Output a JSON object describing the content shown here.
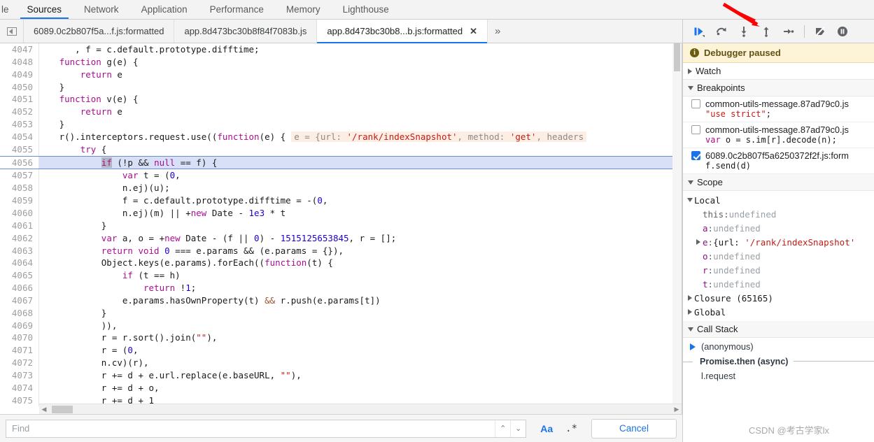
{
  "panel_tabs": [
    {
      "label": "le",
      "active": false,
      "clipped": true
    },
    {
      "label": "Sources",
      "active": true
    },
    {
      "label": "Network",
      "active": false
    },
    {
      "label": "Application",
      "active": false
    },
    {
      "label": "Performance",
      "active": false
    },
    {
      "label": "Memory",
      "active": false
    },
    {
      "label": "Lighthouse",
      "active": false
    }
  ],
  "file_tabs": [
    {
      "label": "6089.0c2b807f5a...f.js:formatted",
      "active": false,
      "closable": false
    },
    {
      "label": "app.8d473bc30b8f84f7083b.js",
      "active": false,
      "closable": false
    },
    {
      "label": "app.8d473bc30b8...b.js:formatted",
      "active": true,
      "closable": true,
      "close_label": "✕"
    }
  ],
  "file_tabs_more": "»",
  "debug_toolbar": {
    "buttons": [
      {
        "name": "resume-script-execution",
        "title": "Resume script execution"
      },
      {
        "name": "step-over-next-function-call",
        "title": "Step over next function call"
      },
      {
        "name": "step-into-next-function-call",
        "title": "Step into next function call"
      },
      {
        "name": "step-out-of-current-function",
        "title": "Step out of current function"
      },
      {
        "name": "step",
        "title": "Step"
      },
      {
        "name": "deactivate-breakpoints",
        "title": "Deactivate breakpoints"
      },
      {
        "name": "pause-on-exceptions",
        "title": "Pause on exceptions"
      }
    ]
  },
  "editor": {
    "first_line_number": 4047,
    "highlighted_line": 4056,
    "lines": [
      {
        "n": 4047,
        "segments": [
          {
            "t": "      , ",
            "c": "plain"
          },
          {
            "t": "f",
            "c": "plain"
          },
          {
            "t": " = ",
            "c": "plain"
          },
          {
            "t": "c",
            "c": "plain"
          },
          {
            "t": ".default.prototype.difftime;",
            "c": "plain"
          }
        ]
      },
      {
        "n": 4048,
        "segments": [
          {
            "t": "   ",
            "c": "plain"
          },
          {
            "t": "function",
            "c": "kw"
          },
          {
            "t": " g(e) {",
            "c": "plain"
          }
        ]
      },
      {
        "n": 4049,
        "segments": [
          {
            "t": "       ",
            "c": "plain"
          },
          {
            "t": "return",
            "c": "kw"
          },
          {
            "t": " e",
            "c": "plain"
          }
        ]
      },
      {
        "n": 4050,
        "segments": [
          {
            "t": "   }",
            "c": "plain"
          }
        ]
      },
      {
        "n": 4051,
        "segments": [
          {
            "t": "   ",
            "c": "plain"
          },
          {
            "t": "function",
            "c": "kw"
          },
          {
            "t": " v(e) {",
            "c": "plain"
          }
        ]
      },
      {
        "n": 4052,
        "segments": [
          {
            "t": "       ",
            "c": "plain"
          },
          {
            "t": "return",
            "c": "kw"
          },
          {
            "t": " e",
            "c": "plain"
          }
        ]
      },
      {
        "n": 4053,
        "segments": [
          {
            "t": "   }",
            "c": "plain"
          }
        ]
      },
      {
        "n": 4054,
        "segments": [
          {
            "t": "   r().interceptors.request.use((",
            "c": "plain"
          },
          {
            "t": "function",
            "c": "kw"
          },
          {
            "t": "(e) {",
            "c": "plain"
          }
        ],
        "hint": true
      },
      {
        "n": 4055,
        "segments": [
          {
            "t": "       ",
            "c": "plain"
          },
          {
            "t": "try",
            "c": "kw"
          },
          {
            "t": " {",
            "c": "plain"
          }
        ]
      },
      {
        "n": 4056,
        "segments": [
          {
            "t": "           ",
            "c": "plain"
          },
          {
            "t": "if",
            "c": "kw sel"
          },
          {
            "t": " (!p && ",
            "c": "plain"
          },
          {
            "t": "null",
            "c": "kw"
          },
          {
            "t": " == f) {",
            "c": "plain"
          }
        ]
      },
      {
        "n": 4057,
        "segments": [
          {
            "t": "               ",
            "c": "plain"
          },
          {
            "t": "var",
            "c": "kw"
          },
          {
            "t": " t = (",
            "c": "plain"
          },
          {
            "t": "0",
            "c": "num"
          },
          {
            "t": ",",
            "c": "plain"
          }
        ]
      },
      {
        "n": 4058,
        "segments": [
          {
            "t": "               n.ej)(u);",
            "c": "plain"
          }
        ]
      },
      {
        "n": 4059,
        "segments": [
          {
            "t": "               f = c.default.prototype.difftime = -(",
            "c": "plain"
          },
          {
            "t": "0",
            "c": "num"
          },
          {
            "t": ",",
            "c": "plain"
          }
        ]
      },
      {
        "n": 4060,
        "segments": [
          {
            "t": "               n.ej)(m) || +",
            "c": "plain"
          },
          {
            "t": "new",
            "c": "kw"
          },
          {
            "t": " Date - ",
            "c": "plain"
          },
          {
            "t": "1e3",
            "c": "num"
          },
          {
            "t": " * t",
            "c": "plain"
          }
        ]
      },
      {
        "n": 4061,
        "segments": [
          {
            "t": "           }",
            "c": "plain"
          }
        ]
      },
      {
        "n": 4062,
        "segments": [
          {
            "t": "           ",
            "c": "plain"
          },
          {
            "t": "var",
            "c": "kw"
          },
          {
            "t": " a, o = +",
            "c": "plain"
          },
          {
            "t": "new",
            "c": "kw"
          },
          {
            "t": " Date - (f || ",
            "c": "plain"
          },
          {
            "t": "0",
            "c": "num"
          },
          {
            "t": ") - ",
            "c": "plain"
          },
          {
            "t": "1515125653845",
            "c": "num"
          },
          {
            "t": ", r = [];",
            "c": "plain"
          }
        ]
      },
      {
        "n": 4063,
        "segments": [
          {
            "t": "           ",
            "c": "plain"
          },
          {
            "t": "return",
            "c": "kw"
          },
          {
            "t": " ",
            "c": "plain"
          },
          {
            "t": "void",
            "c": "kw"
          },
          {
            "t": " ",
            "c": "plain"
          },
          {
            "t": "0",
            "c": "num"
          },
          {
            "t": " === e.params && (e.params = {}),",
            "c": "plain"
          }
        ]
      },
      {
        "n": 4064,
        "segments": [
          {
            "t": "           Object.keys(e.params).forEach((",
            "c": "plain"
          },
          {
            "t": "function",
            "c": "kw"
          },
          {
            "t": "(t) {",
            "c": "plain"
          }
        ]
      },
      {
        "n": 4065,
        "segments": [
          {
            "t": "               ",
            "c": "plain"
          },
          {
            "t": "if",
            "c": "kw"
          },
          {
            "t": " (t == h)",
            "c": "plain"
          }
        ]
      },
      {
        "n": 4066,
        "segments": [
          {
            "t": "                   ",
            "c": "plain"
          },
          {
            "t": "return",
            "c": "kw"
          },
          {
            "t": " !",
            "c": "plain"
          },
          {
            "t": "1",
            "c": "num"
          },
          {
            "t": ";",
            "c": "plain"
          }
        ]
      },
      {
        "n": 4067,
        "segments": [
          {
            "t": "               e.params.hasOwnProperty(t) ",
            "c": "plain"
          },
          {
            "t": "&&",
            "c": "op"
          },
          {
            "t": " r.push(e.params[t])",
            "c": "plain"
          }
        ]
      },
      {
        "n": 4068,
        "segments": [
          {
            "t": "           }",
            "c": "plain"
          }
        ]
      },
      {
        "n": 4069,
        "segments": [
          {
            "t": "           )),",
            "c": "plain"
          }
        ]
      },
      {
        "n": 4070,
        "segments": [
          {
            "t": "           r = r.sort().join(",
            "c": "plain"
          },
          {
            "t": "\"\"",
            "c": "str"
          },
          {
            "t": "),",
            "c": "plain"
          }
        ]
      },
      {
        "n": 4071,
        "segments": [
          {
            "t": "           r = (",
            "c": "plain"
          },
          {
            "t": "0",
            "c": "num"
          },
          {
            "t": ",",
            "c": "plain"
          }
        ]
      },
      {
        "n": 4072,
        "segments": [
          {
            "t": "           n.cv)(r),",
            "c": "plain"
          }
        ]
      },
      {
        "n": 4073,
        "segments": [
          {
            "t": "           r += d + e.url.replace(e.baseURL, ",
            "c": "plain"
          },
          {
            "t": "\"\"",
            "c": "str"
          },
          {
            "t": "),",
            "c": "plain"
          }
        ]
      },
      {
        "n": 4074,
        "segments": [
          {
            "t": "           r += d + o,",
            "c": "plain"
          }
        ]
      },
      {
        "n": 4075,
        "segments": [
          {
            "t": "           r += d + 1",
            "c": "plain"
          }
        ]
      }
    ],
    "inline_hint": {
      "prefix": "e = {",
      "k1": "url",
      "sep1": ": ",
      "v1": "'/rank/indexSnapshot'",
      "sep2": ", ",
      "k2": "method",
      "sep3": ": ",
      "v2": "'get'",
      "sep4": ", ",
      "k3": "headers"
    }
  },
  "sidebar": {
    "paused_banner": {
      "icon": "info-icon",
      "text": "Debugger paused"
    },
    "watch": {
      "label": "Watch",
      "expanded": false
    },
    "breakpoints": {
      "label": "Breakpoints",
      "expanded": true,
      "items": [
        {
          "checked": false,
          "file": "common-utils-message.87ad79c0.js",
          "code_parts": [
            {
              "t": "\"use strict\"",
              "c": "s"
            },
            {
              "t": ";",
              "c": ""
            }
          ]
        },
        {
          "checked": false,
          "file": "common-utils-message.87ad79c0.js",
          "code_parts": [
            {
              "t": "var",
              "c": "k"
            },
            {
              "t": " o = s.im[r].decode(n);",
              "c": ""
            }
          ]
        },
        {
          "checked": true,
          "file": "6089.0c2b807f5a6250372f2f.js:form",
          "code_parts": [
            {
              "t": "f.send(d)",
              "c": ""
            }
          ]
        }
      ]
    },
    "scope": {
      "label": "Scope",
      "expanded": true,
      "rows": [
        {
          "indent": 0,
          "tri": "open",
          "name": "Local",
          "kind": "group"
        },
        {
          "indent": 1,
          "tri": "none",
          "key": "this",
          "key_style": "plain",
          "value": "undefined",
          "value_style": "undef"
        },
        {
          "indent": 1,
          "tri": "none",
          "key": "a",
          "key_style": "prop",
          "value": "undefined",
          "value_style": "undef"
        },
        {
          "indent": 1,
          "tri": "closed",
          "key": "e",
          "key_style": "prop",
          "value": "{url: '/rank/indexSnapshot'",
          "value_style": "obj"
        },
        {
          "indent": 1,
          "tri": "none",
          "key": "o",
          "key_style": "prop",
          "value": "undefined",
          "value_style": "undef"
        },
        {
          "indent": 1,
          "tri": "none",
          "key": "r",
          "key_style": "prop",
          "value": "undefined",
          "value_style": "undef"
        },
        {
          "indent": 1,
          "tri": "none",
          "key": "t",
          "key_style": "prop",
          "value": "undefined",
          "value_style": "undef"
        },
        {
          "indent": 0,
          "tri": "closed",
          "name": "Closure (65165)",
          "kind": "group"
        },
        {
          "indent": 0,
          "tri": "closed",
          "name": "Global",
          "kind": "group"
        }
      ]
    },
    "call_stack": {
      "label": "Call Stack",
      "expanded": true,
      "frames": [
        {
          "label": "(anonymous)",
          "current": true,
          "type": "frame"
        },
        {
          "label": "Promise.then (async)",
          "type": "async"
        },
        {
          "label": "l.request",
          "type": "frame",
          "current": false
        }
      ]
    }
  },
  "find_bar": {
    "placeholder": "Find",
    "value": "",
    "prev_label": "⌃",
    "next_label": "⌄",
    "match_case_label": "Aa",
    "regex_label": ".*",
    "cancel_label": "Cancel"
  },
  "watermark": "CSDN @考古学家lx",
  "colors": {
    "accent": "#1a73e8",
    "paused_bg": "#fdf4d8",
    "highlight_line": "#d7e0f7",
    "inline_hint_bg": "#fdeee4",
    "arrow_red": "#ff0000"
  }
}
